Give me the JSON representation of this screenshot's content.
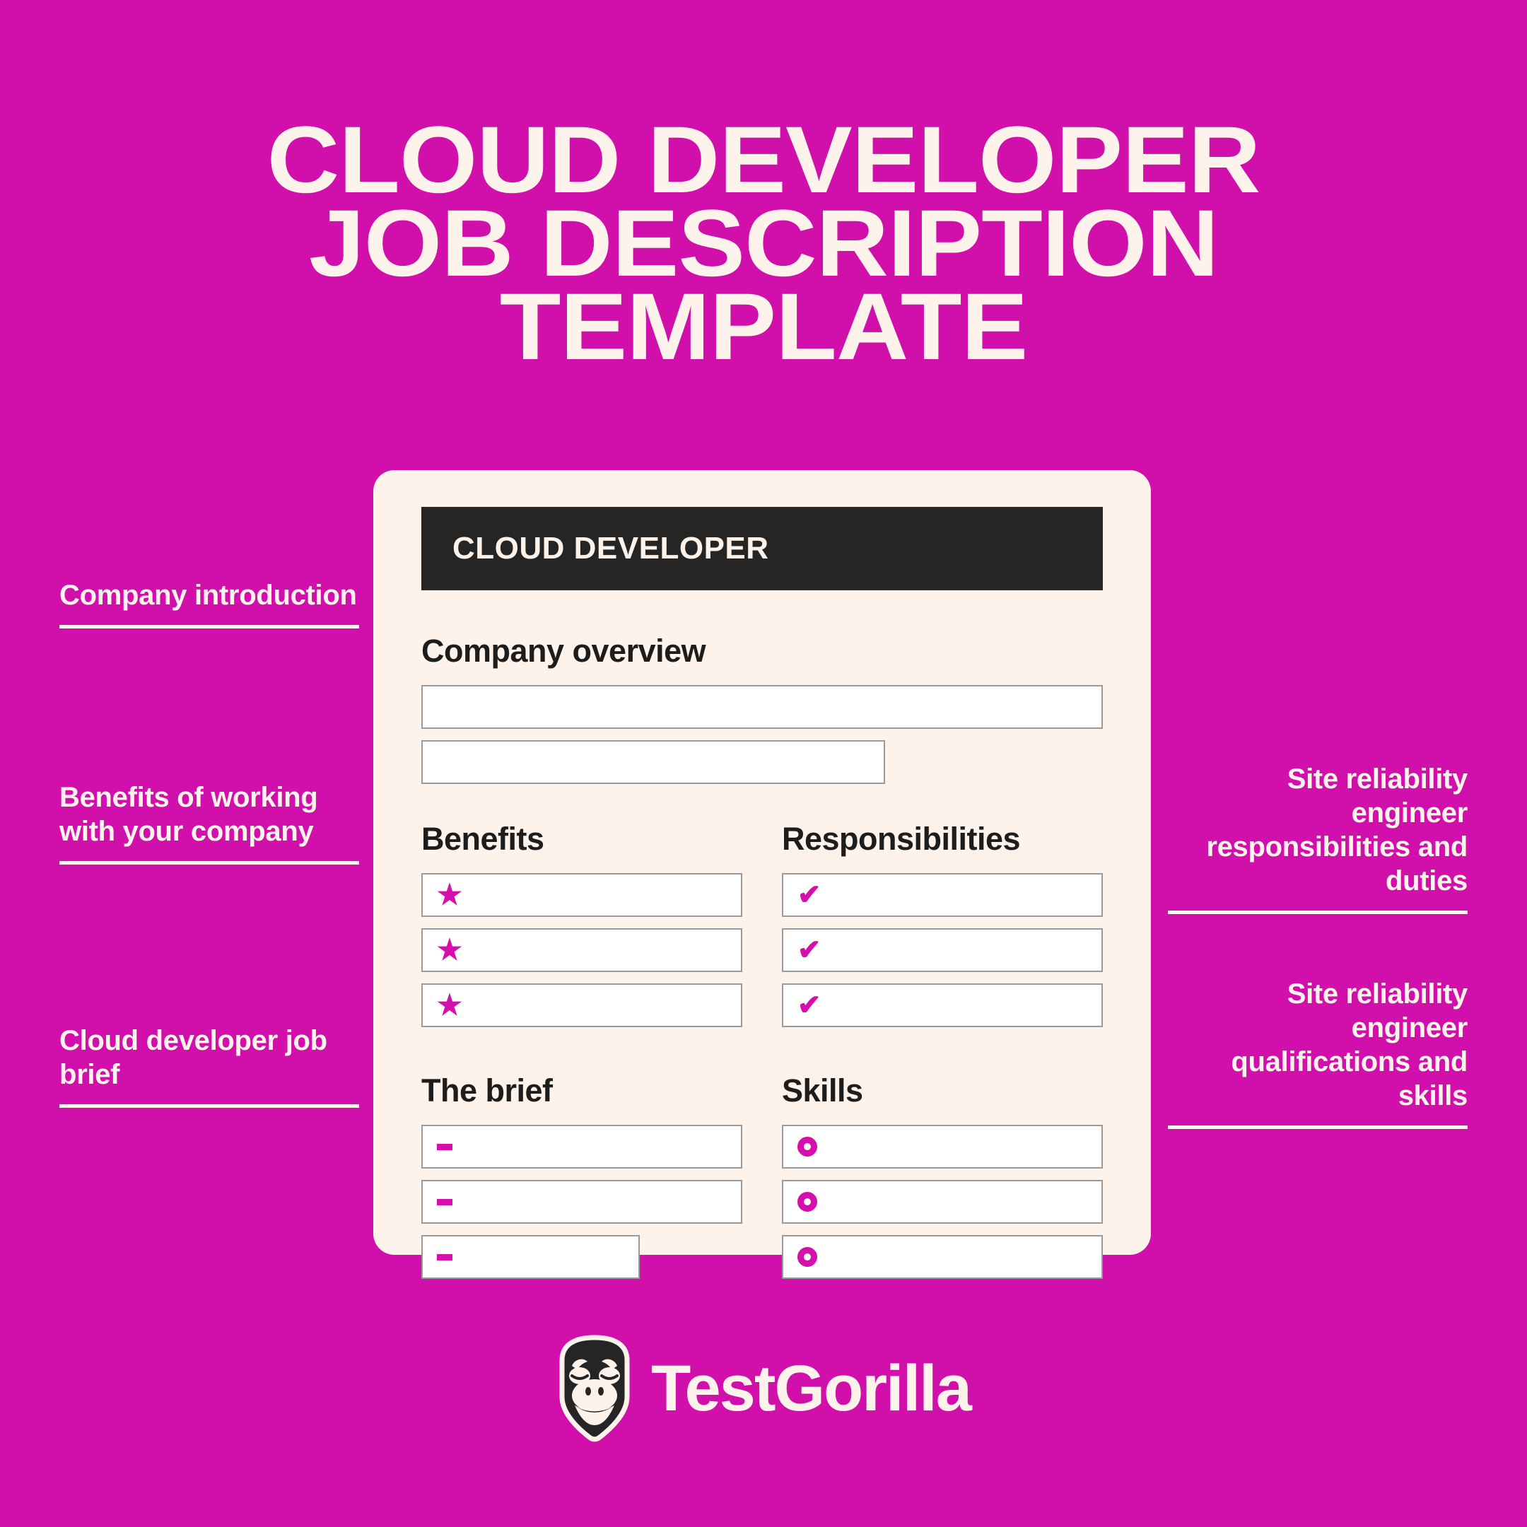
{
  "colors": {
    "background_magenta": "#D10FAB",
    "cream": "#FDF3EA",
    "dark": "#252525",
    "accent_magenta": "#D40FAC",
    "field_border": "#9A9A9A",
    "field_fill": "#FFFFFF"
  },
  "title": {
    "line1": "CLOUD DEVELOPER",
    "line2": "JOB DESCRIPTION",
    "line3": "TEMPLATE"
  },
  "card": {
    "header_title": "CLOUD DEVELOPER",
    "overview": {
      "label": "Company overview",
      "fields": [
        {
          "bullet": "none",
          "width": "full"
        },
        {
          "bullet": "none",
          "width": "short"
        }
      ]
    },
    "columns": [
      {
        "label": "Benefits",
        "bullet_icon": "star-icon",
        "bullet_glyph": "★",
        "fields": [
          {
            "width": "full"
          },
          {
            "width": "full"
          },
          {
            "width": "full"
          }
        ]
      },
      {
        "label": "Responsibilities",
        "bullet_icon": "check-icon",
        "bullet_glyph": "✔",
        "fields": [
          {
            "width": "full"
          },
          {
            "width": "full"
          },
          {
            "width": "full"
          }
        ]
      },
      {
        "label": "The brief",
        "bullet_icon": "dash-icon",
        "bullet_glyph": "-",
        "fields": [
          {
            "width": "full"
          },
          {
            "width": "full"
          },
          {
            "width": "short"
          }
        ]
      },
      {
        "label": "Skills",
        "bullet_icon": "ring-icon",
        "bullet_glyph": "○",
        "fields": [
          {
            "width": "full"
          },
          {
            "width": "full"
          },
          {
            "width": "full"
          }
        ]
      }
    ]
  },
  "annotations": {
    "left": [
      {
        "text": "Company introduction"
      },
      {
        "text": "Benefits of working with your company"
      },
      {
        "text": "Cloud developer job brief"
      }
    ],
    "right": [
      {
        "text": "Site reliability engineer responsibilities and duties"
      },
      {
        "text": "Site reliability engineer qualifications and skills"
      }
    ]
  },
  "footer": {
    "logo_mark": "gorilla-head-icon",
    "brand": "TestGorilla"
  }
}
